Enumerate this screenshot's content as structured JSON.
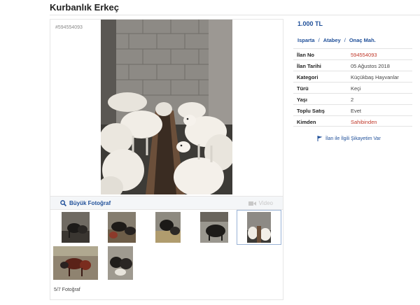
{
  "listing": {
    "title": "Kurbanlık Erkeç",
    "id_label": "#594554093"
  },
  "gallery": {
    "big_photo_label": "Büyük Fotoğraf",
    "video_label": "Video",
    "counter": "5/7 Fotoğraf",
    "selected_index": 5,
    "thumbnails": [
      {
        "label": "photo 1",
        "theme": "dark-goats"
      },
      {
        "label": "photo 2",
        "theme": "black-goats"
      },
      {
        "label": "photo 3",
        "theme": "black-goats-straw"
      },
      {
        "label": "photo 4",
        "theme": "goat-barn"
      },
      {
        "label": "photo 5",
        "theme": "white-sheep"
      },
      {
        "label": "photo 6",
        "theme": "red-goats"
      },
      {
        "label": "photo 7",
        "theme": "black-white-goats"
      }
    ]
  },
  "details": {
    "price": "1.000 TL",
    "location": {
      "province": "Isparta",
      "district": "Atabey",
      "neighborhood": "Onaç Mah.",
      "separator": "/"
    },
    "rows": [
      {
        "label": "İlan No",
        "value": "594554093",
        "red": true
      },
      {
        "label": "İlan Tarihi",
        "value": "05 Ağustos 2018",
        "red": false
      },
      {
        "label": "Kategori",
        "value": "Küçükbaş Hayvanlar",
        "red": false
      },
      {
        "label": "Türü",
        "value": "Keçi",
        "red": false
      },
      {
        "label": "Yaşı",
        "value": "2",
        "red": false
      },
      {
        "label": "Toplu Satış",
        "value": "Evet",
        "red": false
      },
      {
        "label": "Kimden",
        "value": "Sahibinden",
        "red": true
      }
    ],
    "complaint_label": "İlan ile İlgili Şikayetim Var"
  },
  "colors": {
    "accent": "#1f4f99",
    "red": "#c0392b"
  }
}
